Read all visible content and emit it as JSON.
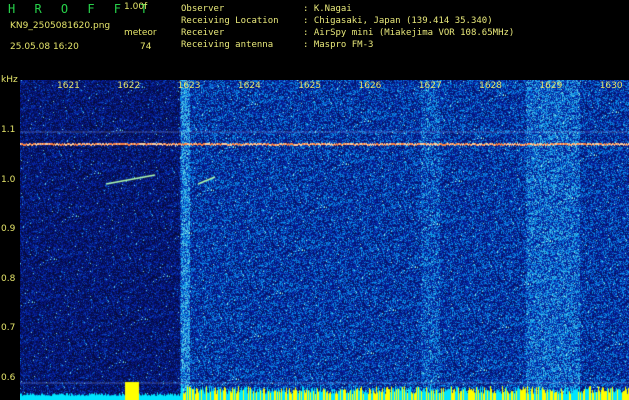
{
  "header": {
    "app_title": "H R O F F T",
    "version": "1.00f",
    "filename": "KN9_2505081620.png",
    "meteor_label": "meteor",
    "timestamp": "25.05.08 16:20",
    "meteor_count": "74",
    "observer_label": "Observer",
    "observer_value": ": K.Nagai",
    "location_label": "Receiving Location",
    "location_value": ": Chigasaki, Japan (139.414 35.340)",
    "receiver_label": "Receiver",
    "receiver_value": ": AirSpy mini (Miakejima VOR 108.65MHz)",
    "antenna_label": "Receiving antenna",
    "antenna_value": ": Maspro FM-3"
  },
  "spectrogram": {
    "unit_label": "kHz",
    "time_ticks": [
      "1621",
      "1622",
      "1623",
      "1624",
      "1625",
      "1626",
      "1627",
      "1628",
      "1629",
      "1630"
    ],
    "freq_ticks": [
      "1.1",
      "1.0",
      "0.9",
      "0.8",
      "0.7",
      "0.6"
    ],
    "colors": {
      "background": "#0a1a8a",
      "carrier": "#ff8040",
      "noise_bar": "#00e5ff",
      "meteor_echo": "#ffff00"
    }
  }
}
